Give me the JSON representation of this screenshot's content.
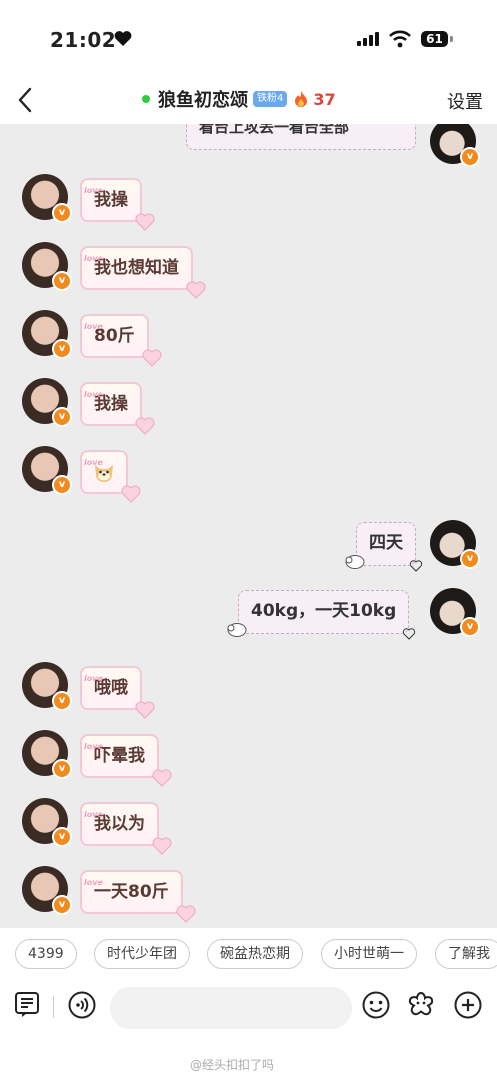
{
  "status": {
    "time": "21:02",
    "battery": "61"
  },
  "nav": {
    "title": "狼鱼初恋颂",
    "fan_badge": "铁粉4",
    "heat": "37",
    "settings": "设置"
  },
  "chat": {
    "top_partial_text": "看台上攻丢一看台全部",
    "messages": [
      {
        "side": "left",
        "text": "我操"
      },
      {
        "side": "left",
        "text": "我也想知道"
      },
      {
        "side": "left",
        "text": "80斤"
      },
      {
        "side": "left",
        "text": "我操"
      },
      {
        "side": "left",
        "text": "",
        "emoji": "dog-face-emoji"
      },
      {
        "side": "right",
        "text": "四天"
      },
      {
        "side": "right",
        "text": "40kg，一天10kg"
      },
      {
        "side": "left",
        "text": "哦哦"
      },
      {
        "side": "left",
        "text": "吓晕我"
      },
      {
        "side": "left",
        "text": "我以为"
      },
      {
        "side": "left",
        "text": "一天80斤"
      }
    ],
    "bubble_tag": "love"
  },
  "chips": [
    "4399",
    "时代少年团",
    "碗盆热恋期",
    "小时世萌一",
    "了解我"
  ],
  "input": {
    "placeholder": ""
  },
  "watermark": "@经头扣扣了吗",
  "colors": {
    "online": "#2ecc40",
    "heat": "#e8413a",
    "vbadge": "#f28a1c",
    "fan_badge": "#6aa9f0"
  }
}
